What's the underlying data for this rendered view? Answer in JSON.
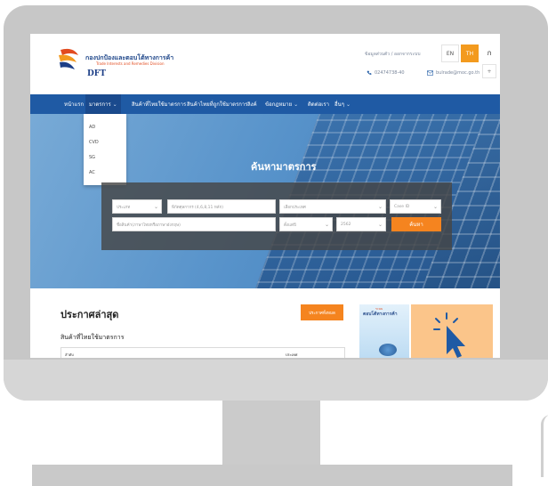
{
  "header": {
    "logo_name": "กองปกป้องและตอบโต้ทางการค้า",
    "logo_subtitle": "Trade Interests and Remedies Division",
    "logo_acronym": "DFT",
    "top_links": "ข้อมูลส่วนตัว / ออกจากระบบ",
    "phone": "02474738-40",
    "email": "bulrade@moc.go.th",
    "lang_en": "EN",
    "lang_th": "TH",
    "font_size_label": "ก",
    "extra_btn": "+"
  },
  "nav": {
    "items": [
      {
        "label": "หน้าแรก"
      },
      {
        "label": "มาตรการ"
      },
      {
        "label": "สินค้าที่ไทยใช้มาตรการ"
      },
      {
        "label": "สินค้าไทยที่ถูกใช้มาตรการ"
      },
      {
        "label": "ลิงค์"
      },
      {
        "label": "ข้อกฎหมาย"
      },
      {
        "label": "ติดต่อเรา"
      },
      {
        "label": "อื่นๆ"
      }
    ]
  },
  "dropdown": {
    "items": [
      "AD",
      "CVD",
      "SG",
      "AC"
    ]
  },
  "hero": {
    "title": "ค้นหามาตรการ"
  },
  "search": {
    "type_placeholder": "ประเภท",
    "code_placeholder": "พิกัดศุลกากร (4,6,8,11 หลัก)",
    "country_placeholder": "เลือกประเทศ",
    "caseid_placeholder": "Case ID",
    "product_placeholder": "ชื่อสินค้า(ภาษาไทยหรือภาษาอังกฤษ)",
    "year_type": "ตั้งแต่ปี",
    "year": "2562",
    "button": "ค้นหา"
  },
  "content": {
    "announce_title": "ประกาศล่าสุด",
    "all_button": "ประกาศทั้งหมด",
    "section_title": "สินค้าที่ไทยใช้มาตรการ",
    "table_col1": "ลำดับ",
    "table_col2": "ประเทศ",
    "banner_text": "ตอบโต้ทางการค้า",
    "banner_subtitle": "ระบบ"
  },
  "colors": {
    "nav": "#1f5aa4",
    "accent": "#f5841f",
    "monitor": "#c7c7c7"
  }
}
